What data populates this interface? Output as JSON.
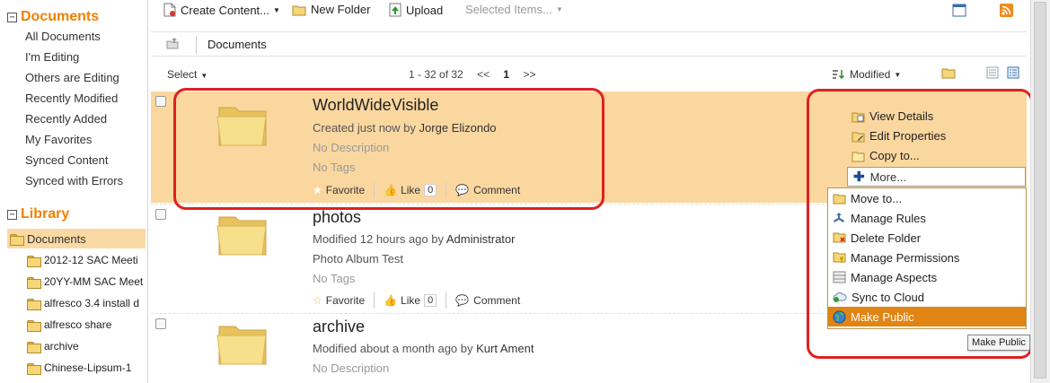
{
  "sidebar": {
    "documents_title": "Documents",
    "documents_items": [
      "All Documents",
      "I'm Editing",
      "Others are Editing",
      "Recently Modified",
      "Recently Added",
      "My Favorites",
      "Synced Content",
      "Synced with Errors"
    ],
    "library_title": "Library",
    "library_root": "Documents",
    "library_items": [
      "2012-12 SAC Meeti",
      "20YY-MM SAC Meet",
      "alfresco 3.4 install d",
      "alfresco share",
      "archive",
      "Chinese-Lipsum-1"
    ],
    "collapse_glyph": "−"
  },
  "toolbar": {
    "create_content": "Create Content...",
    "new_folder": "New Folder",
    "upload": "Upload",
    "selected_items": "Selected Items..."
  },
  "breadcrumb": {
    "current": "Documents"
  },
  "listbar": {
    "select_label": "Select",
    "pager_range": "1 - 32 of 32",
    "prev": "<<",
    "page": "1",
    "next": ">>",
    "sort_label": "Modified"
  },
  "rows": [
    {
      "name": "WorldWideVisible",
      "meta_prefix": "Created just now by",
      "meta_user": "Jorge Elizondo",
      "line2": "No Description",
      "line3": "No Tags",
      "favorite": "Favorite",
      "like": "Like",
      "like_count": "0",
      "comment": "Comment"
    },
    {
      "name": "photos",
      "meta_prefix": "Modified 12 hours ago by",
      "meta_user": "Administrator",
      "line2": "Photo Album Test",
      "line3": "No Tags",
      "favorite": "Favorite",
      "like": "Like",
      "like_count": "0",
      "comment": "Comment"
    },
    {
      "name": "archive",
      "meta_prefix": "Modified about a month ago by",
      "meta_user": "Kurt Ament",
      "line2": "No Description"
    }
  ],
  "row_actions": {
    "view_details": "View Details",
    "edit_properties": "Edit Properties",
    "copy_to": "Copy to...",
    "more": "More...",
    "menu": [
      "Move to...",
      "Manage Rules",
      "Delete Folder",
      "Manage Permissions",
      "Manage Aspects",
      "Sync to Cloud",
      "Make Public"
    ]
  },
  "tooltip": "Make Public",
  "colors": {
    "accent_orange": "#f08000",
    "row_highlight": "#fbd7a0",
    "menu_active": "#e08414",
    "annotation_red": "#e02020"
  }
}
